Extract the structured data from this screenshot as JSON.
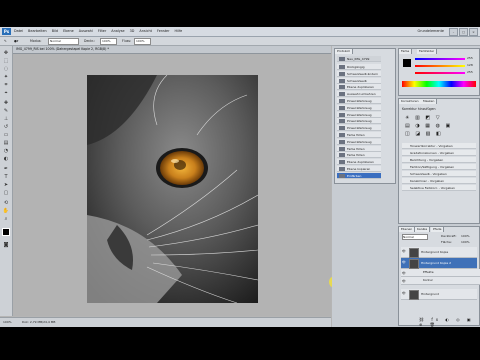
{
  "app": {
    "logo": "Ps",
    "workspace": "Grundelemente"
  },
  "menu": [
    "Datei",
    "Bearbeiten",
    "Bild",
    "Ebene",
    "Auswahl",
    "Filter",
    "Analyse",
    "3D",
    "Ansicht",
    "Fenster",
    "Hilfe"
  ],
  "options": {
    "mode_label": "Modus:",
    "mode_value": "Normal",
    "opacity_label": "Deckr.:",
    "opacity_value": "100%",
    "flow_label": "Fluss:",
    "flow_value": "100%"
  },
  "document": {
    "tab_title": "IMG_4799_RIS bei 100% (Dahergestapel Kopie 2, RGB/8) *"
  },
  "status": {
    "zoom": "100%",
    "info": "Dok: 2,79 MB/24,4 MB"
  },
  "history": {
    "snapshot": "Neu_IMG_4799",
    "items": [
      "Rückgängig",
      "Schwarzweiß ändern",
      "Schwarzweiß",
      "Ebene duplizieren",
      "Auswahl umkehren",
      "Pinsel-Werkzeug",
      "Pinsel-Werkzeug",
      "Pinsel-Werkzeug",
      "Pinsel-Werkzeug",
      "Pinsel-Werkzeug",
      "Farbe füllen",
      "Pinsel-Werkzeug",
      "Farbe füllen",
      "Farbe füllen",
      "Ebene duplizieren",
      "Ebene kopieren",
      "Einfärben"
    ],
    "selected_index": 16
  },
  "color_panel": {
    "tabs": [
      "Farbe",
      "Farbfelder"
    ],
    "values": [
      "255",
      "128",
      "255"
    ]
  },
  "adjust_panel": {
    "tabs": [
      "Korrekturen",
      "Masken"
    ],
    "title": "Korrektur hinzufügen",
    "rows": [
      "Tonwertkorrektur - Vorgaben",
      "Gradationskurven - Vorgaben",
      "Belichtung - Vorgaben",
      "Farbton/Sättigung - Vorgaben",
      "Schwarzweiß - Vorgaben",
      "Kanalmixer - Vorgaben",
      "Selektive Farbkorr. - Vorgaben"
    ]
  },
  "layers": {
    "tabs": [
      "Ebenen",
      "Kanäle",
      "Pfade"
    ],
    "mode": "Normal",
    "opacity_label": "Deckkraft:",
    "opacity": "100%",
    "fill_label": "Fläche:",
    "fill": "100%",
    "rows": [
      "Hintergrund Kopie",
      "Hintergrund Kopie 2",
      "Effekte",
      "Kontur",
      "Hintergrund"
    ],
    "selected_index": 1
  },
  "colors": {
    "accent": "#3a6ec0",
    "eye": "#c9801c"
  }
}
